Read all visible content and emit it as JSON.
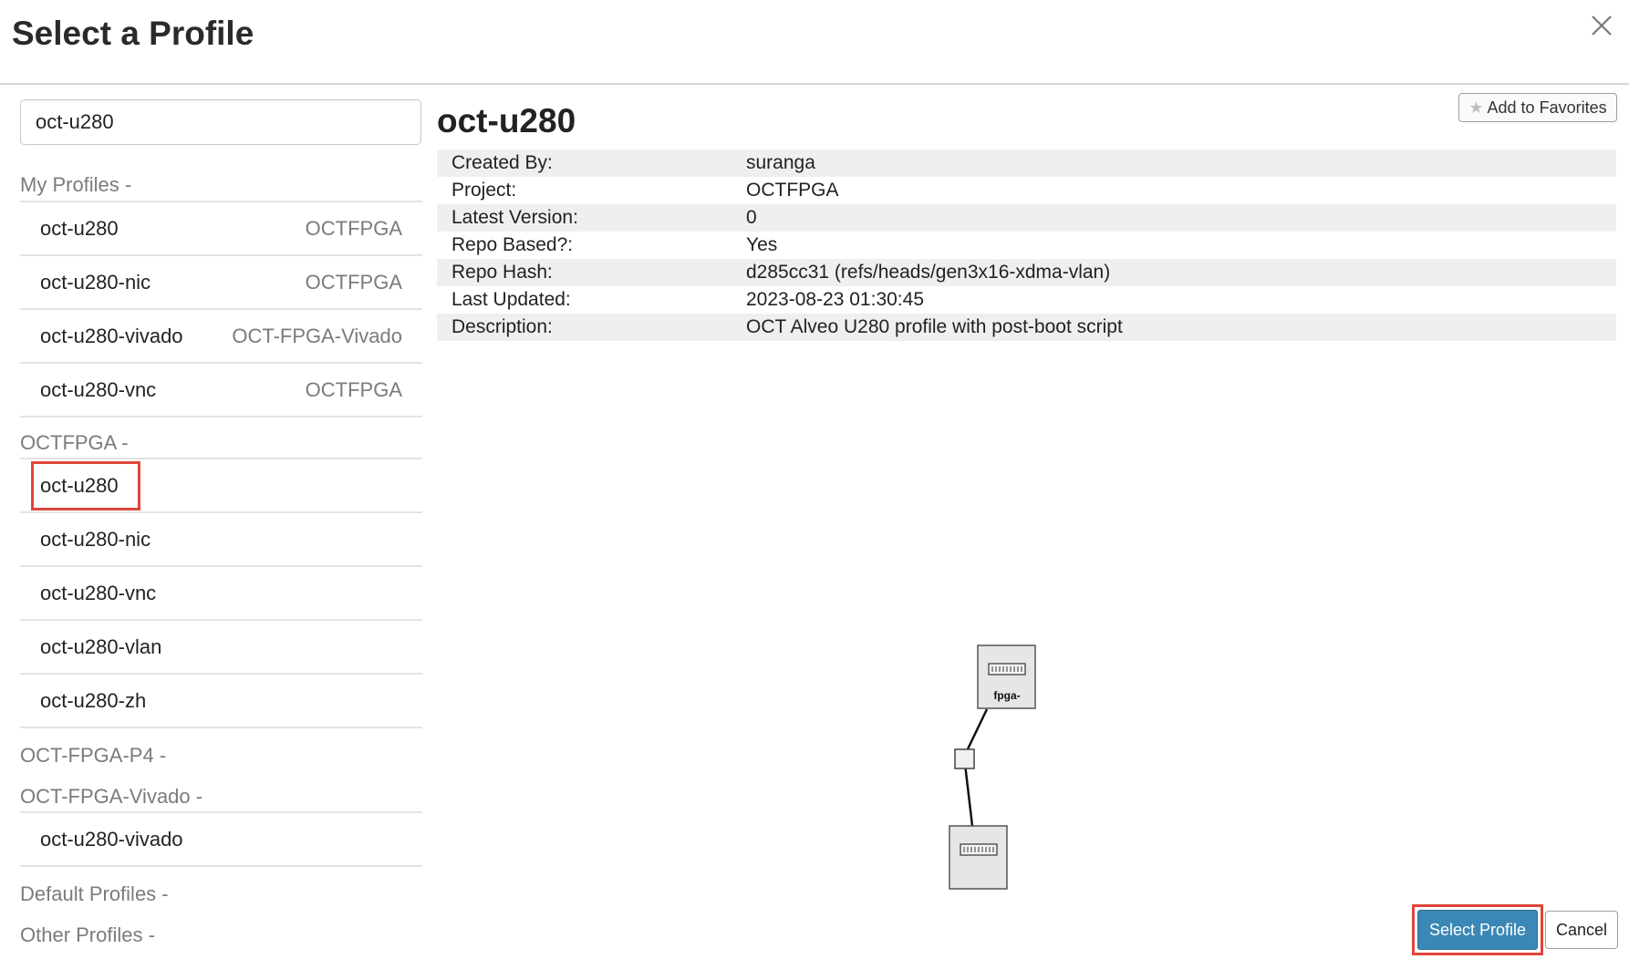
{
  "dialog": {
    "title": "Select a Profile"
  },
  "search": {
    "value": "oct-u280"
  },
  "groups": [
    {
      "label": "My Profiles -",
      "items": [
        {
          "name": "oct-u280",
          "project": "OCTFPGA"
        },
        {
          "name": "oct-u280-nic",
          "project": "OCTFPGA"
        },
        {
          "name": "oct-u280-vivado",
          "project": "OCT-FPGA-Vivado"
        },
        {
          "name": "oct-u280-vnc",
          "project": "OCTFPGA"
        }
      ]
    },
    {
      "label": "OCTFPGA -",
      "items": [
        {
          "name": "oct-u280"
        },
        {
          "name": "oct-u280-nic"
        },
        {
          "name": "oct-u280-vnc"
        },
        {
          "name": "oct-u280-vlan"
        },
        {
          "name": "oct-u280-zh"
        }
      ]
    },
    {
      "label": "OCT-FPGA-P4 -",
      "items": []
    },
    {
      "label": "OCT-FPGA-Vivado -",
      "items": [
        {
          "name": "oct-u280-vivado"
        }
      ]
    },
    {
      "label": "Default Profiles -",
      "items": []
    },
    {
      "label": "Other Profiles -",
      "items": []
    }
  ],
  "selected": {
    "name": "oct-u280",
    "favorites_label": "Add to Favorites",
    "details": [
      {
        "key": "Created By:",
        "value": "suranga"
      },
      {
        "key": "Project:",
        "value": "OCTFPGA"
      },
      {
        "key": "Latest Version:",
        "value": "0"
      },
      {
        "key": "Repo Based?:",
        "value": "Yes"
      },
      {
        "key": "Repo Hash:",
        "value": "d285cc31 (refs/heads/gen3x16-xdma-vlan)"
      },
      {
        "key": "Last Updated:",
        "value": "2023-08-23 01:30:45"
      },
      {
        "key": "Description:",
        "value": "OCT Alveo U280 profile with post-boot script"
      }
    ],
    "topology": {
      "node_label": "fpga-"
    }
  },
  "footer": {
    "select_label": "Select Profile",
    "cancel_label": "Cancel"
  },
  "colors": {
    "accent": "#3b87b5",
    "highlight": "#e0453a"
  }
}
